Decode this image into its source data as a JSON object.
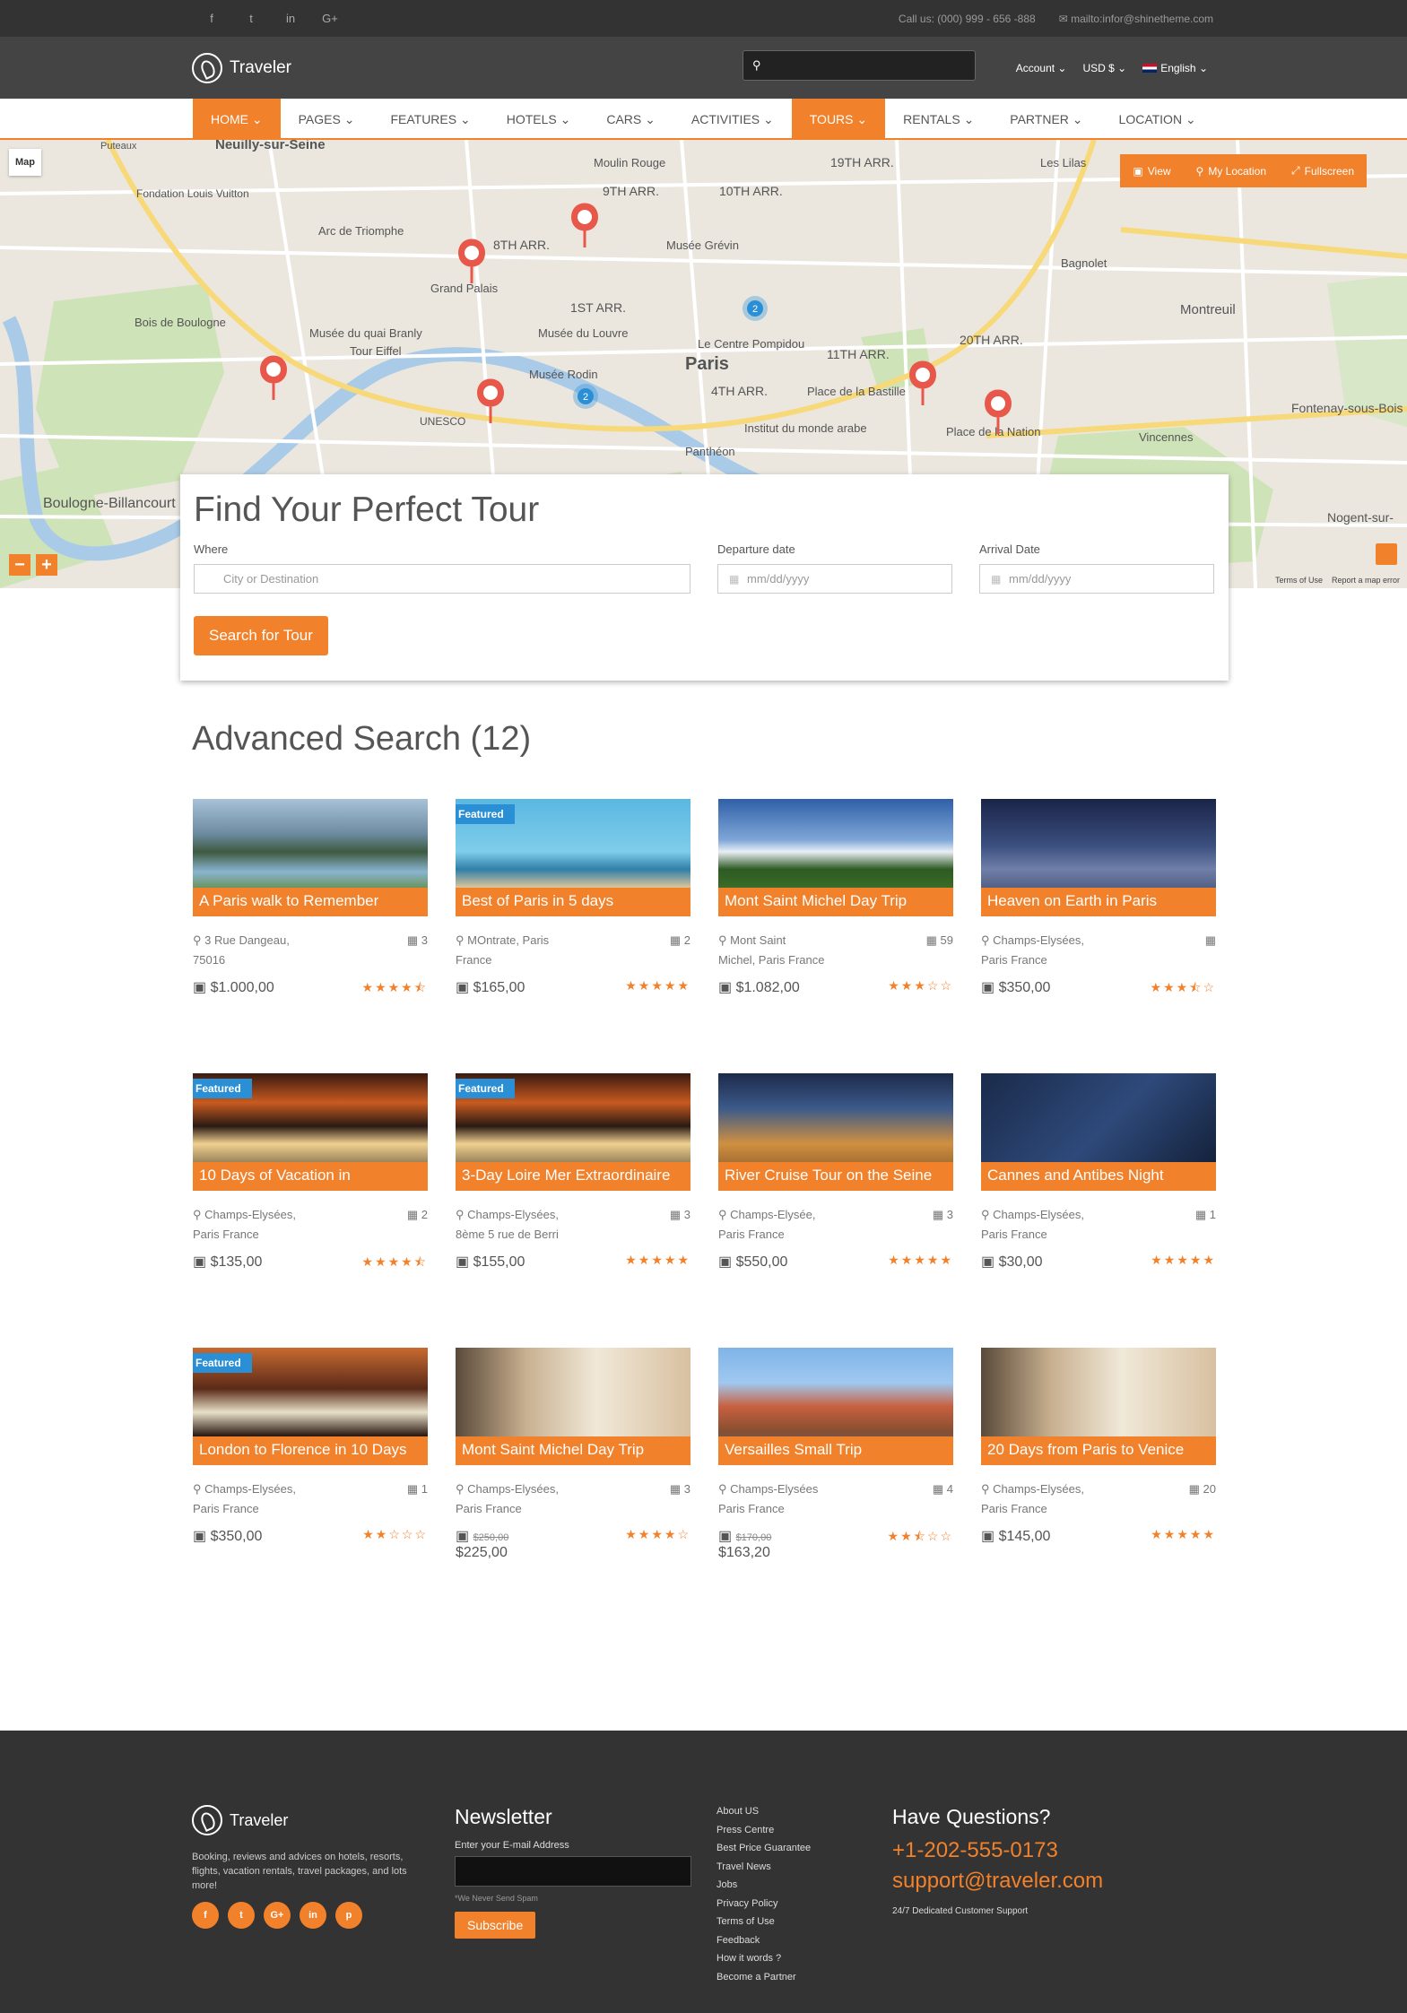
{
  "topbar": {
    "social": [
      "f",
      "t",
      "in",
      "G+"
    ],
    "phone": "Call us: (000) 999 - 656 -888",
    "email": "mailto:infor@shinetheme.com"
  },
  "header": {
    "logo_text": "Traveler",
    "search_value": "",
    "account_label": "Account",
    "currency_label": "USD $",
    "language_label": "English"
  },
  "nav": {
    "items": [
      "HOME",
      "PAGES",
      "FEATURES",
      "HOTELS",
      "CARS",
      "ACTIVITIES",
      "TOURS",
      "RENTALS",
      "PARTNER",
      "LOCATION"
    ]
  },
  "map": {
    "type_label": "Map",
    "controls": [
      "View",
      "My Location",
      "Fullscreen"
    ],
    "zoom_out": "−",
    "zoom_in": "+",
    "terms": "Terms of Use",
    "report": "Report a map error",
    "places": [
      "Neuilly-sur-Seine",
      "Puteaux",
      "Moulin Rouge",
      "19TH ARR.",
      "Les Lilas",
      "Fondation Louis Vuitton",
      "9TH ARR.",
      "10TH ARR.",
      "Arc de Triomphe",
      "8TH ARR.",
      "Musée Grévin",
      "Bagnolet",
      "Grand Palais",
      "1ST ARR.",
      "Montreuil",
      "Musée du quai Branly",
      "Musée du Louvre",
      "Paris",
      "Tour Eiffel",
      "Musée Rodin",
      "11TH ARR.",
      "20TH ARR.",
      "4TH ARR.",
      "Place de la Bastille",
      "Place de la Nation",
      "UNESCO",
      "Institut du monde arabe",
      "Fontenay-sous-Bois",
      "Boulogne-Billancourt",
      "Vincennes",
      "Nogent-sur-",
      "Le Centre Pompidou",
      "Bois de Boulogne",
      "Panthéon"
    ],
    "cluster_counts": [
      "2",
      "2"
    ]
  },
  "search": {
    "title": "Find Your Perfect Tour",
    "where_label": "Where",
    "where_placeholder": "City or Destination",
    "departure_label": "Departure date",
    "departure_placeholder": "mm/dd/yyyy",
    "arrival_label": "Arrival Date",
    "arrival_placeholder": "mm/dd/yyyy",
    "button": "Search for Tour"
  },
  "results": {
    "title": "Advanced Search (12)",
    "featured_label": "Featured",
    "tours": [
      {
        "title": "A Paris walk to Remember",
        "address": "3 Rue Dangeau, 75016",
        "count": "3",
        "price": "$1.000,00",
        "old_price": "",
        "rating": 4.5,
        "featured": false,
        "img": "lake"
      },
      {
        "title": "Best of Paris in 5 days",
        "address": "MOntrate, Paris France",
        "count": "2",
        "price": "$165,00",
        "old_price": "",
        "rating": 5,
        "featured": true,
        "img": "beach"
      },
      {
        "title": "Mont Saint Michel Day Trip",
        "address": "Mont Saint Michel, Paris France",
        "count": "59",
        "price": "$1.082,00",
        "old_price": "",
        "rating": 3,
        "featured": false,
        "img": "cliff"
      },
      {
        "title": "Heaven on Earth in Paris",
        "address": "Champs-Elysées, Paris France",
        "count": "",
        "price": "$350,00",
        "old_price": "",
        "rating": 3.5,
        "featured": false,
        "img": "night"
      },
      {
        "title": "10 Days of Vacation in",
        "address": "Champs-Elysées, Paris France",
        "count": "2",
        "price": "$135,00",
        "old_price": "",
        "rating": 4.5,
        "featured": true,
        "img": "ship"
      },
      {
        "title": "3-Day Loire Mer Extraordinaire",
        "address": "Champs-Elysées, 8ème 5 rue de Berri",
        "count": "3",
        "price": "$155,00",
        "old_price": "",
        "rating": 5,
        "featured": true,
        "img": "ship"
      },
      {
        "title": "River Cruise Tour on the Seine",
        "address": "Champs-Elysée, Paris France",
        "count": "3",
        "price": "$550,00",
        "old_price": "",
        "rating": 5,
        "featured": false,
        "img": "deck"
      },
      {
        "title": "Cannes and Antibes Night",
        "address": "Champs-Elysées, Paris France",
        "count": "1",
        "price": "$30,00",
        "old_price": "",
        "rating": 5,
        "featured": false,
        "img": "bridge"
      },
      {
        "title": "London to Florence in 10 Days",
        "address": "Champs-Elysées, Paris France",
        "count": "1",
        "price": "$350,00",
        "old_price": "",
        "rating": 2,
        "featured": true,
        "img": "ship2"
      },
      {
        "title": "Mont Saint Michel Day Trip",
        "address": "Champs-Elysées, Paris France",
        "count": "3",
        "price": "$225,00",
        "old_price": "$250,00",
        "rating": 4,
        "featured": false,
        "img": "valley"
      },
      {
        "title": "Versailles Small Trip",
        "address": "Champs-Elysées Paris France",
        "count": "4",
        "price": "$163,20",
        "old_price": "$170,00",
        "rating": 2.5,
        "featured": false,
        "img": "houses"
      },
      {
        "title": "20 Days from Paris to Venice",
        "address": "Champs-Elysées, Paris France",
        "count": "20",
        "price": "$145,00",
        "old_price": "",
        "rating": 5,
        "featured": false,
        "img": "valley"
      }
    ]
  },
  "footer": {
    "logo_text": "Traveler",
    "description": "Booking, reviews and advices on hotels, resorts, flights, vacation rentals, travel packages, and lots more!",
    "social": [
      "f",
      "t",
      "G+",
      "in",
      "p"
    ],
    "newsletter_title": "Newsletter",
    "email_label": "Enter your E-mail Address",
    "spam_note": "*We Never Send Spam",
    "subscribe": "Subscribe",
    "links": [
      "About US",
      "Press Centre",
      "Best Price Guarantee",
      "Travel News",
      "Jobs",
      "Privacy Policy",
      "Terms of Use",
      "Feedback",
      "How it words ?",
      "Become a Partner"
    ],
    "questions_title": "Have Questions?",
    "phone": "+1-202-555-0173",
    "email": "support@traveler.com",
    "support_note": "24/7 Dedicated Customer Support"
  },
  "colors": {
    "accent": "#f1812a",
    "featured": "#2b8fd6",
    "dark": "#333333"
  }
}
